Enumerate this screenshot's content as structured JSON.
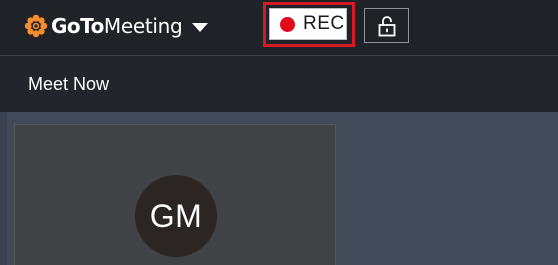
{
  "header": {
    "brand_goto": "GoTo",
    "brand_meeting": "Meeting",
    "rec_label": "REC"
  },
  "menu": {
    "meet_now": "Meet Now"
  },
  "participant": {
    "initials": "GM"
  },
  "colors": {
    "brand_accent": "#f68d2e",
    "rec_dot": "#e2081a",
    "highlight": "#d51a24"
  },
  "icons": {
    "logo": "gotomeeting-logo-icon",
    "caret": "chevron-down-icon",
    "record": "record-dot-icon",
    "lock": "unlock-icon"
  }
}
